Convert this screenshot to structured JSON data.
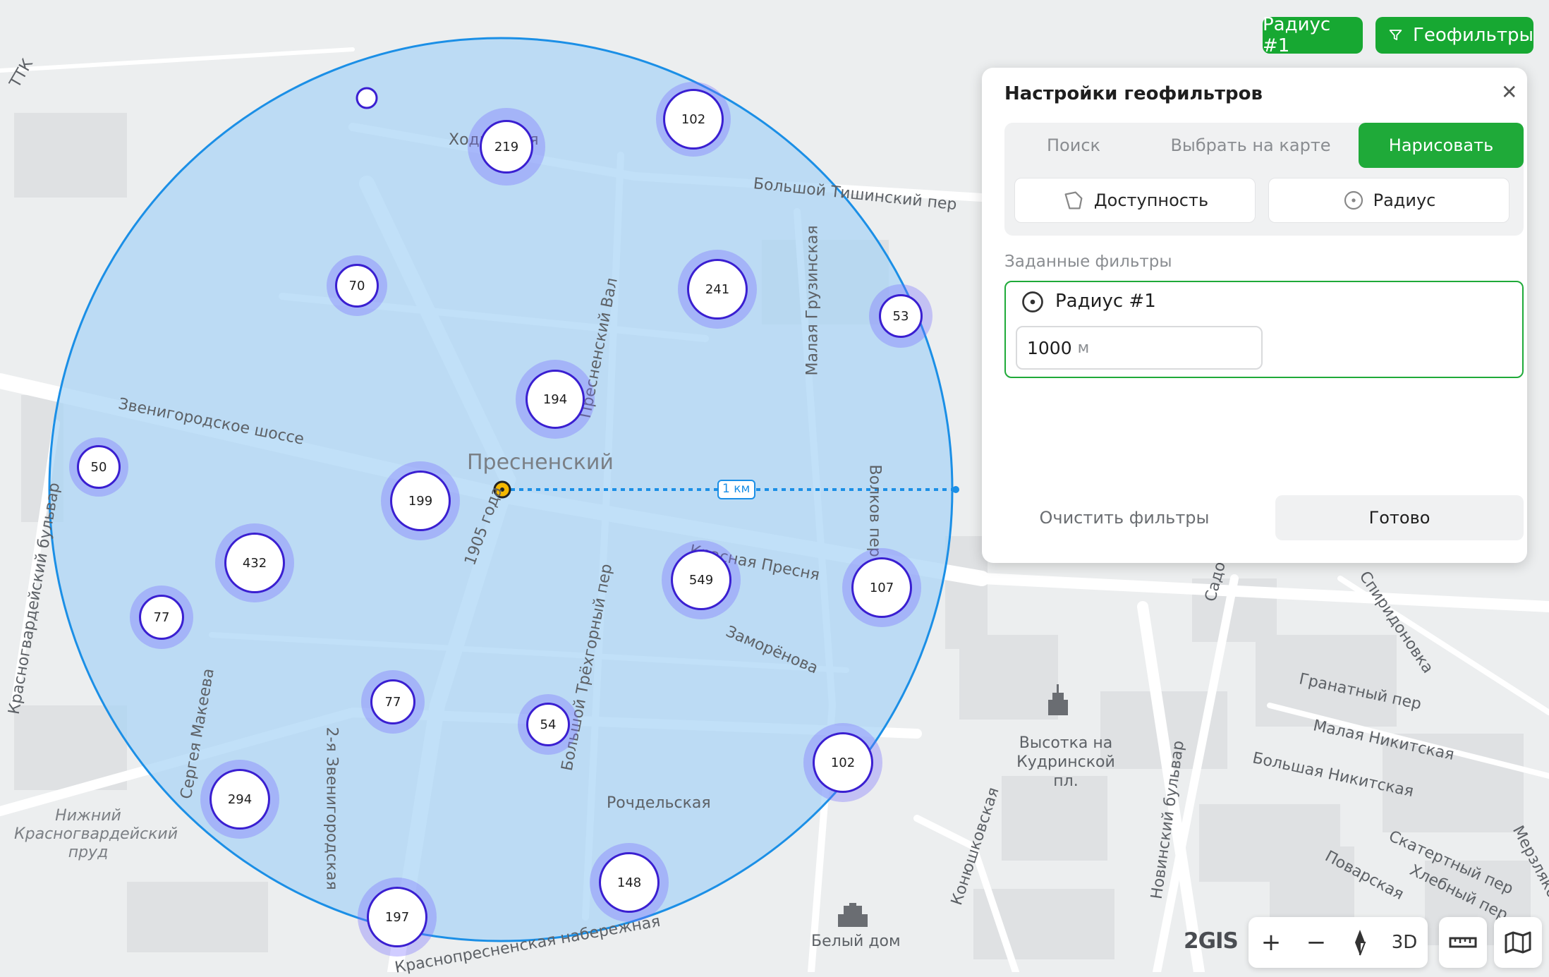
{
  "map": {
    "district": "Пресненский",
    "scale_label": "1 км",
    "streets": [
      {
        "text": "Звенигородское шоссе"
      },
      {
        "text": "Красная Пресня"
      },
      {
        "text": "Заморёнова"
      },
      {
        "text": "Пресненский Вал"
      },
      {
        "text": "Малая Грузинская"
      },
      {
        "text": "Большой Тишинский пер"
      },
      {
        "text": "2-я Звенигородская"
      },
      {
        "text": "Сергея Макеева"
      },
      {
        "text": "Большой Трёхгорный пер"
      },
      {
        "text": "Рочдельская"
      },
      {
        "text": "Волков пер"
      },
      {
        "text": "1905 года"
      },
      {
        "text": "Ходынская"
      },
      {
        "text": "Красногвардейский бульвар"
      },
      {
        "text": "Конюшковская"
      },
      {
        "text": "Новинский бульвар"
      },
      {
        "text": "Гранатный пер"
      },
      {
        "text": "Малая Никитская"
      },
      {
        "text": "Большая Никитская"
      },
      {
        "text": "Скатертный пер"
      },
      {
        "text": "Хлебный пер"
      },
      {
        "text": "Поварская"
      },
      {
        "text": "Спиридоновка"
      },
      {
        "text": "Садовая"
      },
      {
        "text": "Мерзляковский"
      },
      {
        "text": "ТТК"
      },
      {
        "text": "Краснопресненская набережная"
      }
    ],
    "places": {
      "pond": "Нижний Красногвардейский пруд",
      "skyscraper": "Высотка на Кудринской пл.",
      "white_house": "Белый дом"
    },
    "clusters": [
      {
        "count": "102"
      },
      {
        "count": "219"
      },
      {
        "count": "70"
      },
      {
        "count": "241"
      },
      {
        "count": "53"
      },
      {
        "count": "194"
      },
      {
        "count": "50"
      },
      {
        "count": "199"
      },
      {
        "count": "432"
      },
      {
        "count": "549"
      },
      {
        "count": "107"
      },
      {
        "count": "77"
      },
      {
        "count": "77"
      },
      {
        "count": "54"
      },
      {
        "count": "102"
      },
      {
        "count": "294"
      },
      {
        "count": "148"
      },
      {
        "count": "197"
      }
    ]
  },
  "topbar": {
    "radius_chip": "Радиус #1",
    "geofilters_button": "Геофильтры"
  },
  "panel": {
    "title": "Настройки геофильтров",
    "close_glyph": "✕",
    "tabs": [
      "Поиск",
      "Выбрать на карте",
      "Нарисовать"
    ],
    "active_tab": "Нарисовать",
    "draw_options": {
      "accessibility": "Доступность",
      "radius": "Радиус"
    },
    "filters_heading": "Заданные фильтры",
    "filter": {
      "name": "Радиус #1",
      "value": "1000",
      "unit": "м"
    },
    "clear_button": "Очистить фильтры",
    "done_button": "Готово"
  },
  "controls": {
    "brand": "2GIS",
    "zoom_in": "+",
    "zoom_out": "−",
    "compass_icon": "compass-icon",
    "mode_3d": "3D",
    "ruler_icon": "ruler-icon",
    "layers_icon": "map-layers-icon"
  },
  "colors": {
    "accent": "#1faa39",
    "circle_fill": "#a9d4f5",
    "circle_stroke": "#1b8fe6",
    "cluster_ring": "#3a1fd1"
  }
}
